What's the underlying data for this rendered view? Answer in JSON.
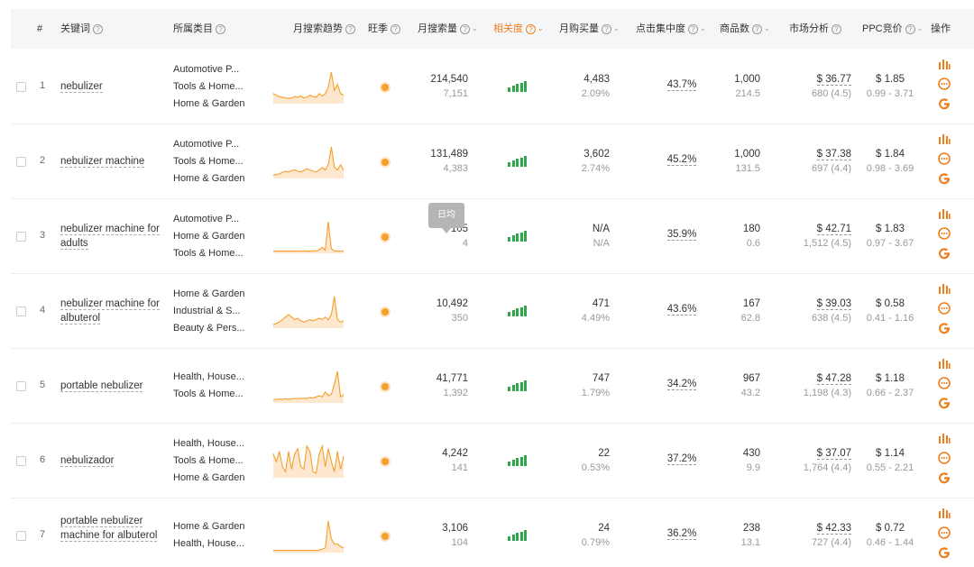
{
  "headers": {
    "rank": "#",
    "keyword": "关键词",
    "category": "所属类目",
    "trend": "月搜索趋势",
    "season": "旺季",
    "monthly_search": "月搜索量",
    "relevance": "相关度",
    "monthly_purchase": "月购买量",
    "click_concentration": "点击集中度",
    "product_count": "商品数",
    "market": "市场分析",
    "ppc": "PPC竞价",
    "actions": "操作",
    "help": "?",
    "sort": "⌄"
  },
  "tooltip": "日均",
  "colors": {
    "accent": "#f07f1b",
    "relevance_bars": "#2ea84a",
    "season_dot": "#f5a02a",
    "sparkline": "#f5a02a"
  },
  "action_icons": [
    "bar-chart-icon",
    "more-circle-icon",
    "google-icon"
  ],
  "rows": [
    {
      "rank": "1",
      "keyword": "nebulizer",
      "categories": [
        "Automotive P...",
        "Tools & Home...",
        "Home & Garden"
      ],
      "trend": [
        3,
        2.5,
        2,
        1.8,
        1.6,
        1.4,
        1.6,
        2,
        1.8,
        2.2,
        1.6,
        1.8,
        2.5,
        2,
        1.8,
        3,
        2.2,
        3,
        5,
        10,
        4,
        6,
        3,
        2.5
      ],
      "search": "214,540",
      "search_daily": "7,151",
      "relevance_level": 5,
      "purchase": "4,483",
      "purchase_rate": "2.09%",
      "click": "43.7%",
      "products": "1,000",
      "products_ratio": "214.5",
      "price": "$ 36.77",
      "rating": "680 (4.5)",
      "ppc": "$ 1.85",
      "ppc_range": "0.99 - 3.71"
    },
    {
      "rank": "2",
      "keyword": "nebulizer machine",
      "categories": [
        "Automotive P...",
        "Tools & Home...",
        "Home & Garden"
      ],
      "trend": [
        1,
        1.2,
        1.5,
        2,
        2.5,
        2.2,
        2.8,
        3,
        2.5,
        2.2,
        2.8,
        3.5,
        3,
        2.5,
        2.2,
        3,
        4,
        3,
        5,
        12,
        4,
        3,
        5,
        3
      ],
      "search": "131,489",
      "search_daily": "4,383",
      "relevance_level": 5,
      "purchase": "3,602",
      "purchase_rate": "2.74%",
      "click": "45.2%",
      "products": "1,000",
      "products_ratio": "131.5",
      "price": "$ 37.38",
      "rating": "697 (4.4)",
      "ppc": "$ 1.84",
      "ppc_range": "0.98 - 3.69"
    },
    {
      "rank": "3",
      "keyword": "nebulizer machine for adults",
      "categories": [
        "Automotive P...",
        "Home & Garden",
        "Tools & Home..."
      ],
      "trend": [
        0.5,
        0.5,
        0.5,
        0.5,
        0.5,
        0.5,
        0.5,
        0.5,
        0.5,
        0.5,
        0.6,
        0.5,
        0.5,
        0.6,
        0.6,
        1,
        2,
        0.8,
        12,
        1.5,
        0.6,
        0.6,
        0.5,
        0.5
      ],
      "search": "105",
      "search_daily": "4",
      "relevance_level": 5,
      "purchase": "N/A",
      "purchase_rate": "N/A",
      "click": "35.9%",
      "products": "180",
      "products_ratio": "0.6",
      "price": "$ 42.71",
      "rating": "1,512 (4.5)",
      "ppc": "$ 1.83",
      "ppc_range": "0.97 - 3.67"
    },
    {
      "rank": "4",
      "keyword": "nebulizer machine for albuterol",
      "categories": [
        "Home & Garden",
        "Industrial & S...",
        "Beauty & Pers..."
      ],
      "trend": [
        1,
        1.5,
        2,
        3,
        4,
        5,
        4,
        3,
        3.5,
        2.5,
        2,
        2.5,
        3,
        2.5,
        3,
        3.5,
        3,
        4,
        3,
        5,
        12,
        3,
        2,
        2.5
      ],
      "search": "10,492",
      "search_daily": "350",
      "relevance_level": 5,
      "purchase": "471",
      "purchase_rate": "4.49%",
      "click": "43.6%",
      "products": "167",
      "products_ratio": "62.8",
      "price": "$ 39.03",
      "rating": "638 (4.5)",
      "ppc": "$ 0.58",
      "ppc_range": "0.41 - 1.16"
    },
    {
      "rank": "5",
      "keyword": "portable nebulizer",
      "categories": [
        "Health, House...",
        "Tools & Home..."
      ],
      "trend": [
        1,
        1,
        1.2,
        1,
        1.3,
        1.1,
        1.2,
        1.4,
        1.3,
        1.5,
        1.4,
        1.5,
        1.8,
        1.6,
        2,
        2.5,
        2,
        4,
        2.5,
        3,
        7,
        12,
        2,
        3
      ],
      "search": "41,771",
      "search_daily": "1,392",
      "relevance_level": 5,
      "purchase": "747",
      "purchase_rate": "1.79%",
      "click": "34.2%",
      "products": "967",
      "products_ratio": "43.2",
      "price": "$ 47.28",
      "rating": "1,198 (4.3)",
      "ppc": "$ 1.18",
      "ppc_range": "0.66 - 2.37"
    },
    {
      "rank": "6",
      "keyword": "nebulizador",
      "categories": [
        "Health, House...",
        "Tools & Home...",
        "Home & Garden"
      ],
      "trend": [
        9,
        6,
        10,
        4,
        2,
        10,
        3,
        9,
        11,
        4,
        3,
        12,
        10,
        2,
        1.5,
        9,
        12,
        4,
        11,
        6,
        2,
        10,
        3,
        8
      ],
      "search": "4,242",
      "search_daily": "141",
      "relevance_level": 5,
      "purchase": "22",
      "purchase_rate": "0.53%",
      "click": "37.2%",
      "products": "430",
      "products_ratio": "9.9",
      "price": "$ 37.07",
      "rating": "1,764 (4.4)",
      "ppc": "$ 1.14",
      "ppc_range": "0.55 - 2.21"
    },
    {
      "rank": "7",
      "keyword": "portable nebulizer machine for albuterol",
      "categories": [
        "Home & Garden",
        "Health, House..."
      ],
      "trend": [
        0.5,
        0.5,
        0.5,
        0.5,
        0.5,
        0.5,
        0.5,
        0.5,
        0.5,
        0.5,
        0.5,
        0.5,
        0.5,
        0.5,
        0.5,
        0.6,
        1,
        1.5,
        12,
        5,
        3,
        3,
        2,
        1.5
      ],
      "search": "3,106",
      "search_daily": "104",
      "relevance_level": 5,
      "purchase": "24",
      "purchase_rate": "0.79%",
      "click": "36.2%",
      "products": "238",
      "products_ratio": "13.1",
      "price": "$ 42.33",
      "rating": "727 (4.4)",
      "ppc": "$ 0.72",
      "ppc_range": "0.46 - 1.44"
    }
  ]
}
